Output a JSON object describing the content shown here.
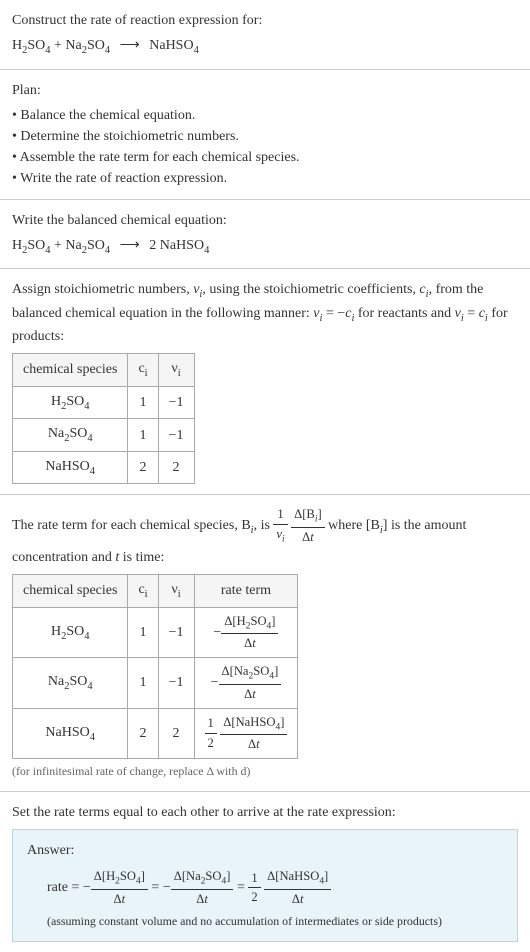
{
  "prompt": {
    "title": "Construct the rate of reaction expression for:",
    "equation_html": "H<sub>2</sub>SO<sub>4</sub> + Na<sub>2</sub>SO<sub>4</sub> <span class='arrow'>⟶</span> NaHSO<sub>4</sub>"
  },
  "plan": {
    "title": "Plan:",
    "items": [
      "Balance the chemical equation.",
      "Determine the stoichiometric numbers.",
      "Assemble the rate term for each chemical species.",
      "Write the rate of reaction expression."
    ]
  },
  "balanced": {
    "title": "Write the balanced chemical equation:",
    "equation_html": "H<sub>2</sub>SO<sub>4</sub> + Na<sub>2</sub>SO<sub>4</sub> <span class='arrow'>⟶</span> 2 NaHSO<sub>4</sub>"
  },
  "assign": {
    "intro_html": "Assign stoichiometric numbers, <span class='ital'>ν<sub>i</sub></span>, using the stoichiometric coefficients, <span class='ital'>c<sub>i</sub></span>, from the balanced chemical equation in the following manner: <span class='ital'>ν<sub>i</sub></span> = −<span class='ital'>c<sub>i</sub></span> for reactants and <span class='ital'>ν<sub>i</sub></span> = <span class='ital'>c<sub>i</sub></span> for products:",
    "headers": [
      "chemical species",
      "c<sub>i</sub>",
      "ν<sub>i</sub>"
    ],
    "rows": [
      [
        "H<sub>2</sub>SO<sub>4</sub>",
        "1",
        "−1"
      ],
      [
        "Na<sub>2</sub>SO<sub>4</sub>",
        "1",
        "−1"
      ],
      [
        "NaHSO<sub>4</sub>",
        "2",
        "2"
      ]
    ]
  },
  "rateterm": {
    "intro_html": "The rate term for each chemical species, B<sub><i>i</i></sub>, is <span class='frac'><span class='num'>1</span><span class='den'><i>ν<sub>i</sub></i></span></span> <span class='frac'><span class='num'>Δ[B<sub><i>i</i></sub>]</span><span class='den'>Δ<i>t</i></span></span> where [B<sub><i>i</i></sub>] is the amount concentration and <i>t</i> is time:",
    "headers": [
      "chemical species",
      "c<sub>i</sub>",
      "ν<sub>i</sub>",
      "rate term"
    ],
    "rows": [
      [
        "H<sub>2</sub>SO<sub>4</sub>",
        "1",
        "−1",
        "−<span class='frac'><span class='num'>Δ[H<sub>2</sub>SO<sub>4</sub>]</span><span class='den'>Δ<i>t</i></span></span>"
      ],
      [
        "Na<sub>2</sub>SO<sub>4</sub>",
        "1",
        "−1",
        "−<span class='frac'><span class='num'>Δ[Na<sub>2</sub>SO<sub>4</sub>]</span><span class='den'>Δ<i>t</i></span></span>"
      ],
      [
        "NaHSO<sub>4</sub>",
        "2",
        "2",
        "<span class='frac'><span class='num'>1</span><span class='den'>2</span></span> <span class='frac'><span class='num'>Δ[NaHSO<sub>4</sub>]</span><span class='den'>Δ<i>t</i></span></span>"
      ]
    ],
    "note": "(for infinitesimal rate of change, replace Δ with d)"
  },
  "final": {
    "title": "Set the rate terms equal to each other to arrive at the rate expression:",
    "answer_label": "Answer:",
    "rate_html": "rate = −<span class='frac'><span class='num'>Δ[H<sub>2</sub>SO<sub>4</sub>]</span><span class='den'>Δ<i>t</i></span></span> = −<span class='frac'><span class='num'>Δ[Na<sub>2</sub>SO<sub>4</sub>]</span><span class='den'>Δ<i>t</i></span></span> = <span class='frac'><span class='num'>1</span><span class='den'>2</span></span> <span class='frac'><span class='num'>Δ[NaHSO<sub>4</sub>]</span><span class='den'>Δ<i>t</i></span></span>",
    "assume": "(assuming constant volume and no accumulation of intermediates or side products)"
  }
}
